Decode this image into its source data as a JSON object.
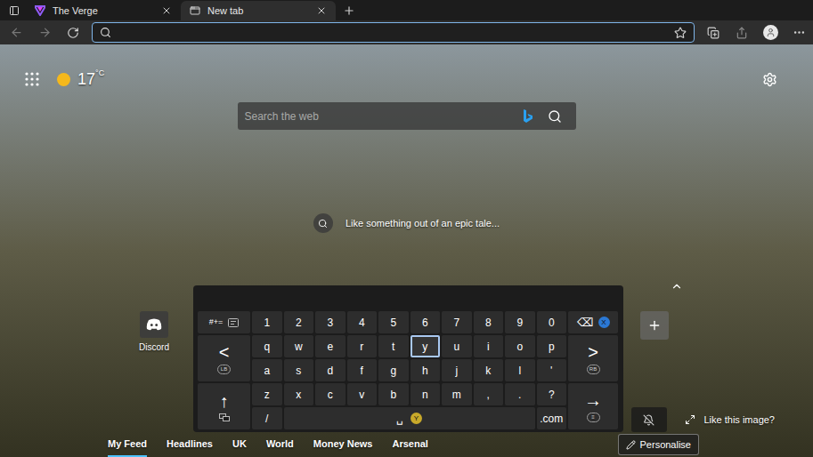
{
  "browser": {
    "tabs": [
      {
        "label": "The Verge",
        "selected": false,
        "kind": "site"
      },
      {
        "label": "New tab",
        "selected": true,
        "kind": "newtab"
      }
    ],
    "address_bar": {
      "focused": true
    }
  },
  "new_tab": {
    "weather": {
      "temperature": "17",
      "unit": "°C"
    },
    "search": {
      "placeholder": "Search the web"
    },
    "image_caption": "Like something out of an epic tale...",
    "shortcuts": [
      {
        "label": "Discord"
      }
    ],
    "like_image": "Like this image?",
    "feed_tabs": [
      {
        "label": "My Feed",
        "selected": true
      },
      {
        "label": "Headlines",
        "selected": false
      },
      {
        "label": "UK",
        "selected": false
      },
      {
        "label": "World",
        "selected": false
      },
      {
        "label": "Money News",
        "selected": false
      },
      {
        "label": "Arsenal",
        "selected": false
      }
    ],
    "personalise": "Personalise"
  },
  "keyboard": {
    "keys": [
      {
        "label": "#+=",
        "kind": "mode",
        "selected": false
      },
      {
        "label": "1",
        "kind": "char",
        "selected": false
      },
      {
        "label": "2",
        "kind": "char",
        "selected": false
      },
      {
        "label": "3",
        "kind": "char",
        "selected": false
      },
      {
        "label": "4",
        "kind": "char",
        "selected": false
      },
      {
        "label": "5",
        "kind": "char",
        "selected": false
      },
      {
        "label": "6",
        "kind": "char",
        "selected": false
      },
      {
        "label": "7",
        "kind": "char",
        "selected": false
      },
      {
        "label": "8",
        "kind": "char",
        "selected": false
      },
      {
        "label": "9",
        "kind": "char",
        "selected": false
      },
      {
        "label": "0",
        "kind": "char",
        "selected": false
      },
      {
        "label": "⌫",
        "kind": "backspace",
        "selected": false,
        "badge": "X",
        "badge_color": "#2b78d4"
      },
      {
        "label": "<",
        "kind": "side",
        "selected": false,
        "badge": "LB"
      },
      {
        "label": "q",
        "kind": "char",
        "selected": false
      },
      {
        "label": "w",
        "kind": "char",
        "selected": false
      },
      {
        "label": "e",
        "kind": "char",
        "selected": false
      },
      {
        "label": "r",
        "kind": "char",
        "selected": false
      },
      {
        "label": "t",
        "kind": "char",
        "selected": false
      },
      {
        "label": "y",
        "kind": "char",
        "selected": true
      },
      {
        "label": "u",
        "kind": "char",
        "selected": false
      },
      {
        "label": "i",
        "kind": "char",
        "selected": false
      },
      {
        "label": "o",
        "kind": "char",
        "selected": false
      },
      {
        "label": "p",
        "kind": "char",
        "selected": false
      },
      {
        "label": ">",
        "kind": "side",
        "selected": false,
        "badge": "RB"
      },
      {
        "label": "a",
        "kind": "char",
        "selected": false
      },
      {
        "label": "s",
        "kind": "char",
        "selected": false
      },
      {
        "label": "d",
        "kind": "char",
        "selected": false
      },
      {
        "label": "f",
        "kind": "char",
        "selected": false
      },
      {
        "label": "g",
        "kind": "char",
        "selected": false
      },
      {
        "label": "h",
        "kind": "char",
        "selected": false
      },
      {
        "label": "j",
        "kind": "char",
        "selected": false
      },
      {
        "label": "k",
        "kind": "char",
        "selected": false
      },
      {
        "label": "l",
        "kind": "char",
        "selected": false
      },
      {
        "label": "'",
        "kind": "char",
        "selected": false
      },
      {
        "label": "↑",
        "kind": "shift",
        "selected": false
      },
      {
        "label": "z",
        "kind": "char",
        "selected": false
      },
      {
        "label": "x",
        "kind": "char",
        "selected": false
      },
      {
        "label": "c",
        "kind": "char",
        "selected": false
      },
      {
        "label": "v",
        "kind": "char",
        "selected": false
      },
      {
        "label": "b",
        "kind": "char",
        "selected": false
      },
      {
        "label": "n",
        "kind": "char",
        "selected": false
      },
      {
        "label": "m",
        "kind": "char",
        "selected": false
      },
      {
        "label": ",",
        "kind": "char",
        "selected": false
      },
      {
        "label": ".",
        "kind": "char",
        "selected": false
      },
      {
        "label": "?",
        "kind": "char",
        "selected": false
      },
      {
        "label": "→",
        "kind": "side",
        "selected": false,
        "badge": "≡"
      },
      {
        "label": "/",
        "kind": "char",
        "selected": false
      },
      {
        "label": "␣",
        "kind": "space",
        "selected": false,
        "badge": "Y",
        "badge_color": "#c8a92a"
      },
      {
        "label": ".com",
        "kind": "char",
        "selected": false
      }
    ]
  }
}
